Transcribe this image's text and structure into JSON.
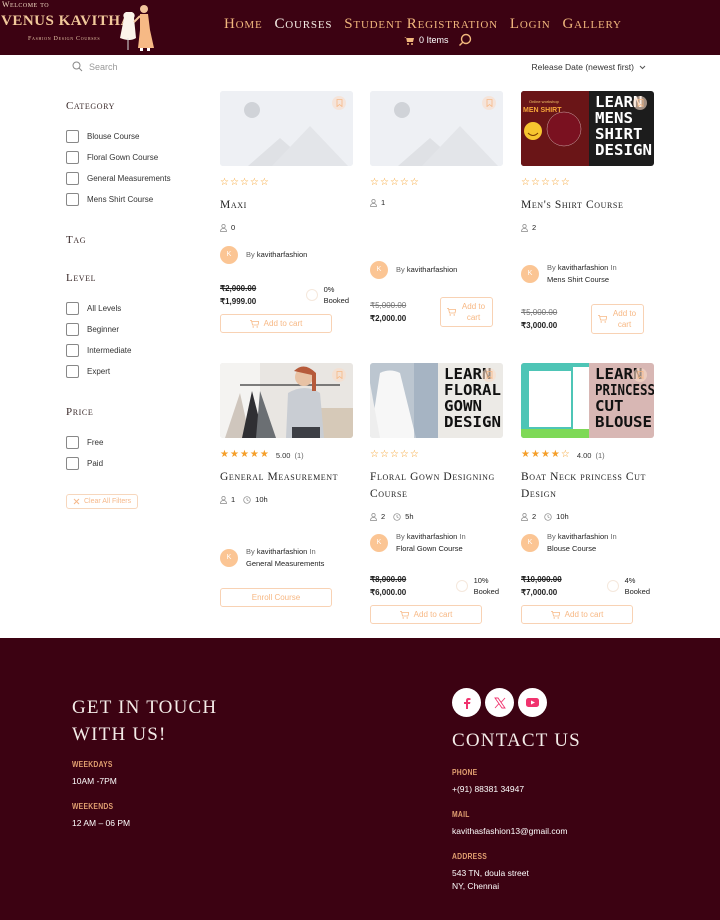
{
  "header": {
    "logo_top": "Welcome to",
    "logo_main": "VENUS KAVITHA",
    "logo_sub": "Fashion Design Courses",
    "nav": [
      {
        "label": "Home",
        "active": false
      },
      {
        "label": "Courses",
        "active": true
      },
      {
        "label": "Student Registration",
        "active": false
      },
      {
        "label": "Login",
        "active": false
      },
      {
        "label": "Gallery",
        "active": false
      }
    ],
    "cart_label": "0 Items"
  },
  "toolbar": {
    "search_placeholder": "Search",
    "sort_value": "Release Date (newest first)"
  },
  "sidebar": {
    "category_title": "Category",
    "categories": [
      "Blouse Course",
      "Floral Gown Course",
      "General Measurements",
      "Mens Shirt Course"
    ],
    "tag_title": "Tag",
    "level_title": "Level",
    "levels": [
      "All Levels",
      "Beginner",
      "Intermediate",
      "Expert"
    ],
    "price_title": "Price",
    "prices": [
      "Free",
      "Paid"
    ],
    "clear_label": "Clear All Filters"
  },
  "courses": [
    {
      "title": "Maxi",
      "rating": "",
      "reviews": "",
      "stars": 0,
      "students": "0",
      "duration": "",
      "author_initial": "K",
      "by": "By",
      "author": "kavitharfashion",
      "in": "",
      "category": "",
      "old_price": "₹2,000.00",
      "price": "₹1,999.00",
      "booked_pct": "0%",
      "booked_label": "Booked",
      "button": "Add to cart",
      "image": "placeholder"
    },
    {
      "title": "",
      "rating": "",
      "reviews": "",
      "stars": 0,
      "students": "1",
      "duration": "",
      "author_initial": "K",
      "by": "By",
      "author": "kavitharfashion",
      "in": "",
      "category": "",
      "old_price": "₹5,000.00",
      "price": "₹2,000.00",
      "booked_pct": "",
      "booked_label": "",
      "button": "Add to cart",
      "image": "placeholder"
    },
    {
      "title": "Men's Shirt Course",
      "rating": "",
      "reviews": "",
      "stars": 0,
      "students": "2",
      "duration": "",
      "author_initial": "K",
      "by": "By",
      "author": "kavitharfashion",
      "in": "In",
      "category": "Mens Shirt Course",
      "old_price": "₹5,000.00",
      "price": "₹3,000.00",
      "booked_pct": "",
      "booked_label": "",
      "button": "Add to cart",
      "image": "LEARN MENS SHIRT DESIGN"
    },
    {
      "title": "General Measurement",
      "rating": "5.00",
      "reviews": "(1)",
      "stars": 5,
      "students": "1",
      "duration": "10h",
      "author_initial": "K",
      "by": "By",
      "author": "kavitharfashion",
      "in": "In",
      "category": "General Measurements",
      "old_price": "",
      "price": "",
      "booked_pct": "",
      "booked_label": "",
      "button": "Enroll Course",
      "image": "photo"
    },
    {
      "title": "Floral Gown Designing Course",
      "rating": "",
      "reviews": "",
      "stars": 0,
      "students": "2",
      "duration": "5h",
      "author_initial": "K",
      "by": "By",
      "author": "kavitharfashion",
      "in": "In",
      "category": "Floral Gown Course",
      "old_price": "₹8,000.00",
      "price": "₹6,000.00",
      "booked_pct": "10%",
      "booked_label": "Booked",
      "button": "Add to cart",
      "image": "LEARN FLORAL GOWN DESIGN"
    },
    {
      "title": "Boat Neck princess Cut Design",
      "rating": "4.00",
      "reviews": "(1)",
      "stars": 4,
      "students": "2",
      "duration": "10h",
      "author_initial": "K",
      "by": "By",
      "author": "kavitharfashion",
      "in": "In",
      "category": "Blouse Course",
      "old_price": "₹10,000.00",
      "price": "₹7,000.00",
      "booked_pct": "4%",
      "booked_label": "Booked",
      "button": "Add to cart",
      "image": "LEARN PRINCESS CUT BLOUSE"
    }
  ],
  "footer": {
    "touch_title_1": "GET IN TOUCH",
    "touch_title_2": "WITH US!",
    "weekdays_label": "WEEKDAYS",
    "weekdays_value": "10AM -7PM",
    "weekends_label": "WEEKENDS",
    "weekends_value": "12 AM – 06 PM",
    "contact_title": "CONTACT US",
    "phone_label": "PHONE",
    "phone_value": "+(91) 88381 34947",
    "mail_label": "MAIL",
    "mail_value": "kavithasfashion13@gmail.com",
    "address_label": "ADDRESS",
    "address_line1": "543 TN, doula street",
    "address_line2": "NY, Chennai",
    "social": [
      "facebook-icon",
      "x-twitter-icon",
      "youtube-icon"
    ]
  },
  "colors": {
    "brand": "#3c0212",
    "accent": "#f1b77d",
    "star": "#f59f2a",
    "social": "#f0336e"
  }
}
